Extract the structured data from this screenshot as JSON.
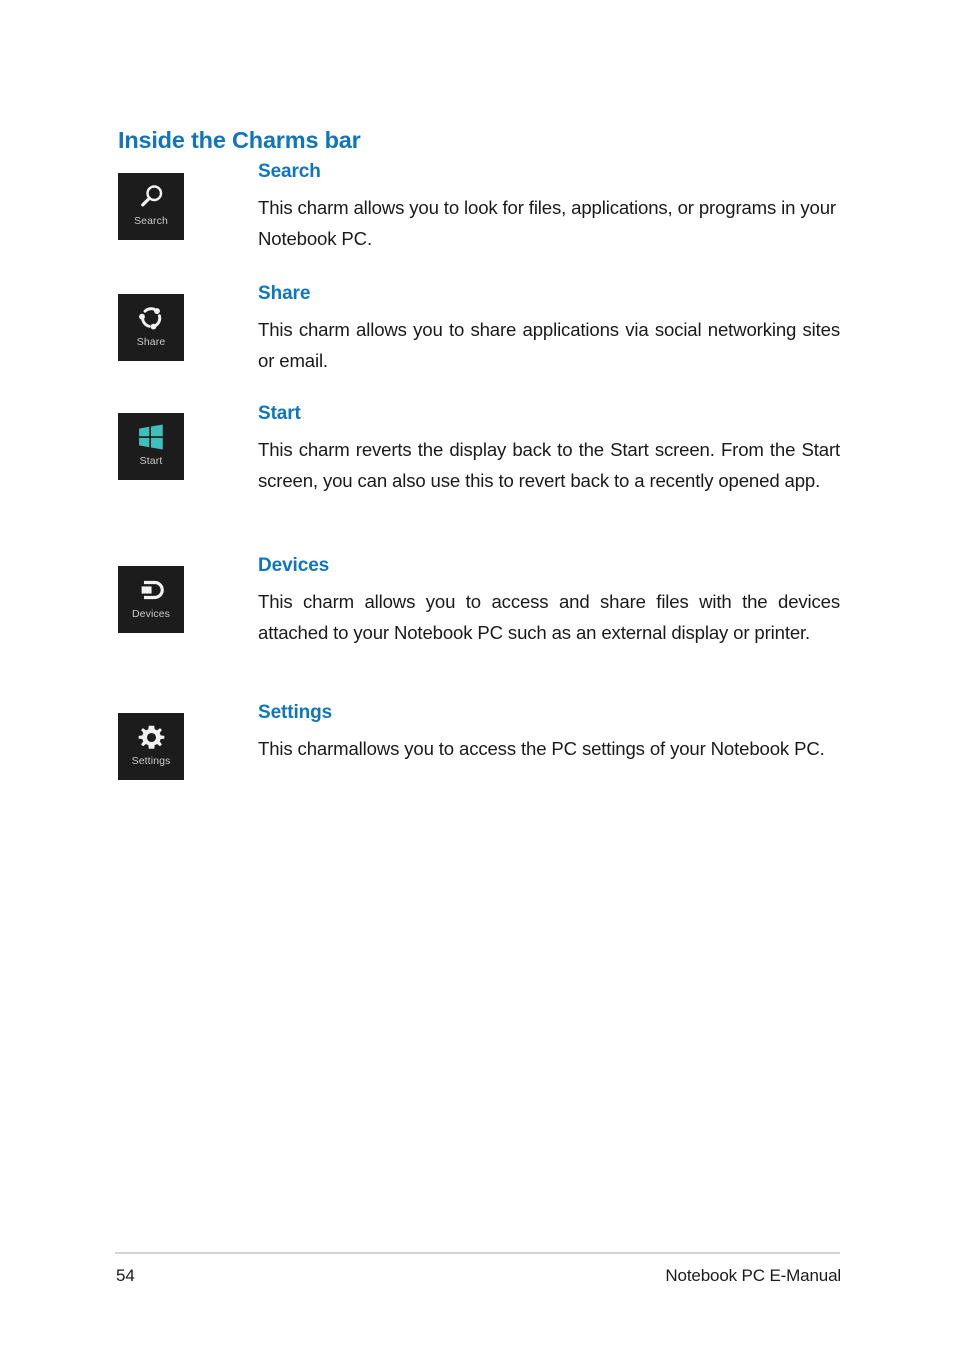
{
  "document": {
    "page_number": "54",
    "footer_title": "Notebook PC E-Manual",
    "heading": "Inside the Charms bar",
    "heading_color": "#0f76bd",
    "body_color": "#1a1a1a",
    "tile_background": "#1c1c1c",
    "start_logo_color": "#3fbfbb"
  },
  "charms": [
    {
      "tile_label": "Search",
      "icon": "magnifier-icon",
      "title": "Search",
      "text": "This charm allows you to look for files, applications, or programs in your Notebook PC.",
      "justified": false
    },
    {
      "tile_label": "Share",
      "icon": "share-circle-icon",
      "title": "Share",
      "text": "This charm allows you to share applications via social networking sites or email.",
      "justified": true
    },
    {
      "tile_label": "Start",
      "icon": "windows-logo-icon",
      "title": "Start",
      "text": "This charm reverts the display back to the Start screen. From the Start screen, you can also use this to revert back to a recently opened app.",
      "justified": true
    },
    {
      "tile_label": "Devices",
      "icon": "devices-icon",
      "title": "Devices",
      "text": "This charm allows you to access and share files with the devices attached to your Notebook PC such as an external display or printer.",
      "justified": true
    },
    {
      "tile_label": "Settings",
      "icon": "gear-icon",
      "title": "Settings",
      "text": "This charmallows you to access the PC settings of your Notebook PC.",
      "justified": true
    }
  ]
}
